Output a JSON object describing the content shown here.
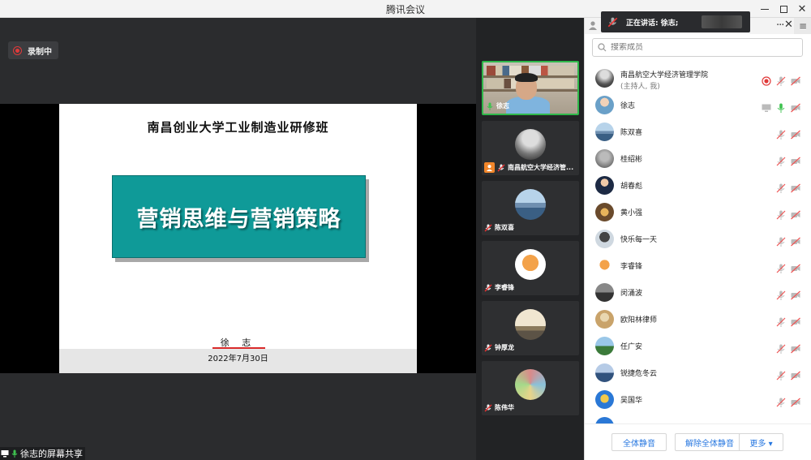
{
  "window": {
    "title": "腾讯会议"
  },
  "recording": {
    "label": "录制中"
  },
  "slide": {
    "heading": "南昌创业大学工业制造业研修班",
    "main_title": "营销思维与营销策略",
    "author": "徐 志",
    "date": "2022年7月30日",
    "colors": {
      "box": "#0f9a98",
      "underline": "#d92b2b"
    }
  },
  "screen_share": {
    "label": "徐志的屏幕共享"
  },
  "videos": [
    {
      "name": "徐志",
      "active": true,
      "type": "camera"
    },
    {
      "name": "南昌航空大学经济管...",
      "active": false,
      "type": "avatar",
      "host": true
    },
    {
      "name": "陈双喜",
      "active": false,
      "type": "avatar"
    },
    {
      "name": "李睿锋",
      "active": false,
      "type": "avatar"
    },
    {
      "name": "钟厚龙",
      "active": false,
      "type": "avatar"
    },
    {
      "name": "陈伟华",
      "active": false,
      "type": "avatar"
    }
  ],
  "panel": {
    "speaking": "正在讲话: 徐志;",
    "search_placeholder": "搜索成员",
    "members": [
      {
        "name": "南昌航空大学经济管理学院",
        "sub": "(主持人, 我)",
        "recording": true,
        "mic": "muted",
        "cam": "off"
      },
      {
        "name": "徐志",
        "sub": "",
        "sharing": true,
        "mic": "on",
        "cam": "off"
      },
      {
        "name": "陈双喜",
        "sub": "",
        "mic": "muted",
        "cam": "off"
      },
      {
        "name": "桂绍彬",
        "sub": "",
        "mic": "muted",
        "cam": "off"
      },
      {
        "name": "胡春彪",
        "sub": "",
        "mic": "muted",
        "cam": "off"
      },
      {
        "name": "黄小强",
        "sub": "",
        "mic": "muted",
        "cam": "off"
      },
      {
        "name": "快乐每一天",
        "sub": "",
        "mic": "muted",
        "cam": "off"
      },
      {
        "name": "李睿锋",
        "sub": "",
        "mic": "muted",
        "cam": "off"
      },
      {
        "name": "闵涌波",
        "sub": "",
        "mic": "muted",
        "cam": "off"
      },
      {
        "name": "欧阳林律师",
        "sub": "",
        "mic": "muted",
        "cam": "off"
      },
      {
        "name": "任广安",
        "sub": "",
        "mic": "muted",
        "cam": "off"
      },
      {
        "name": "锐捷危冬云",
        "sub": "",
        "mic": "muted",
        "cam": "off"
      },
      {
        "name": "吴国华",
        "sub": "",
        "mic": "muted",
        "cam": "off"
      }
    ],
    "buttons": {
      "mute_all": "全体静音",
      "unmute_all": "解除全体静音",
      "more": "更多 ▾"
    }
  }
}
